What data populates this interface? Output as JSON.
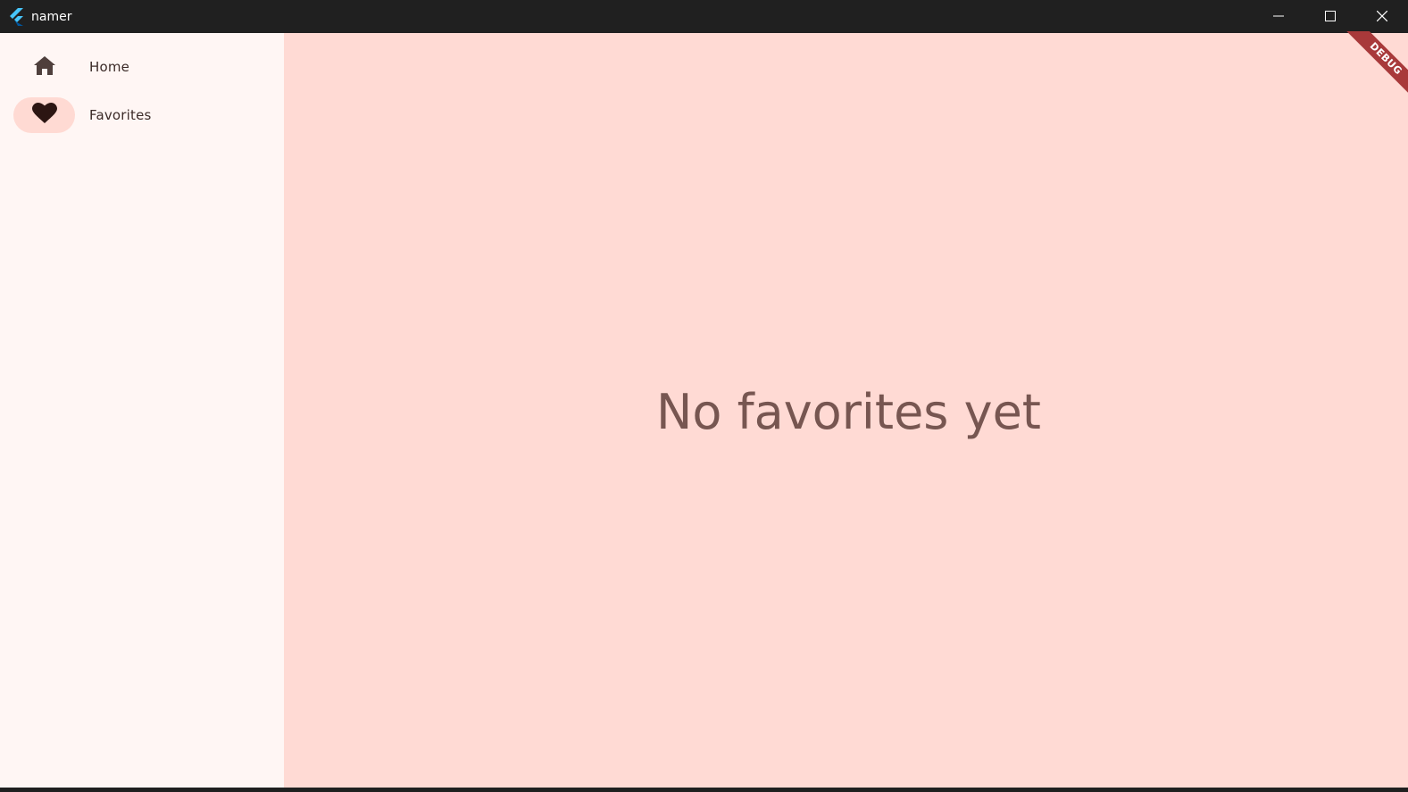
{
  "window": {
    "title": "namer",
    "controls": [
      "minimize",
      "maximize",
      "close"
    ]
  },
  "sidebar": {
    "items": [
      {
        "label": "Home",
        "icon": "home-icon",
        "selected": false
      },
      {
        "label": "Favorites",
        "icon": "heart-icon",
        "selected": true
      }
    ]
  },
  "main": {
    "message": "No favorites yet"
  },
  "debug_banner": {
    "label": "DEBUG"
  },
  "colors": {
    "titlebar": "#202020",
    "sidebar_bg": "#fff6f4",
    "main_bg": "#ffdad4",
    "indicator": "#ffdad3",
    "message_text": "#775651",
    "debug_banner": "#a8393a"
  }
}
